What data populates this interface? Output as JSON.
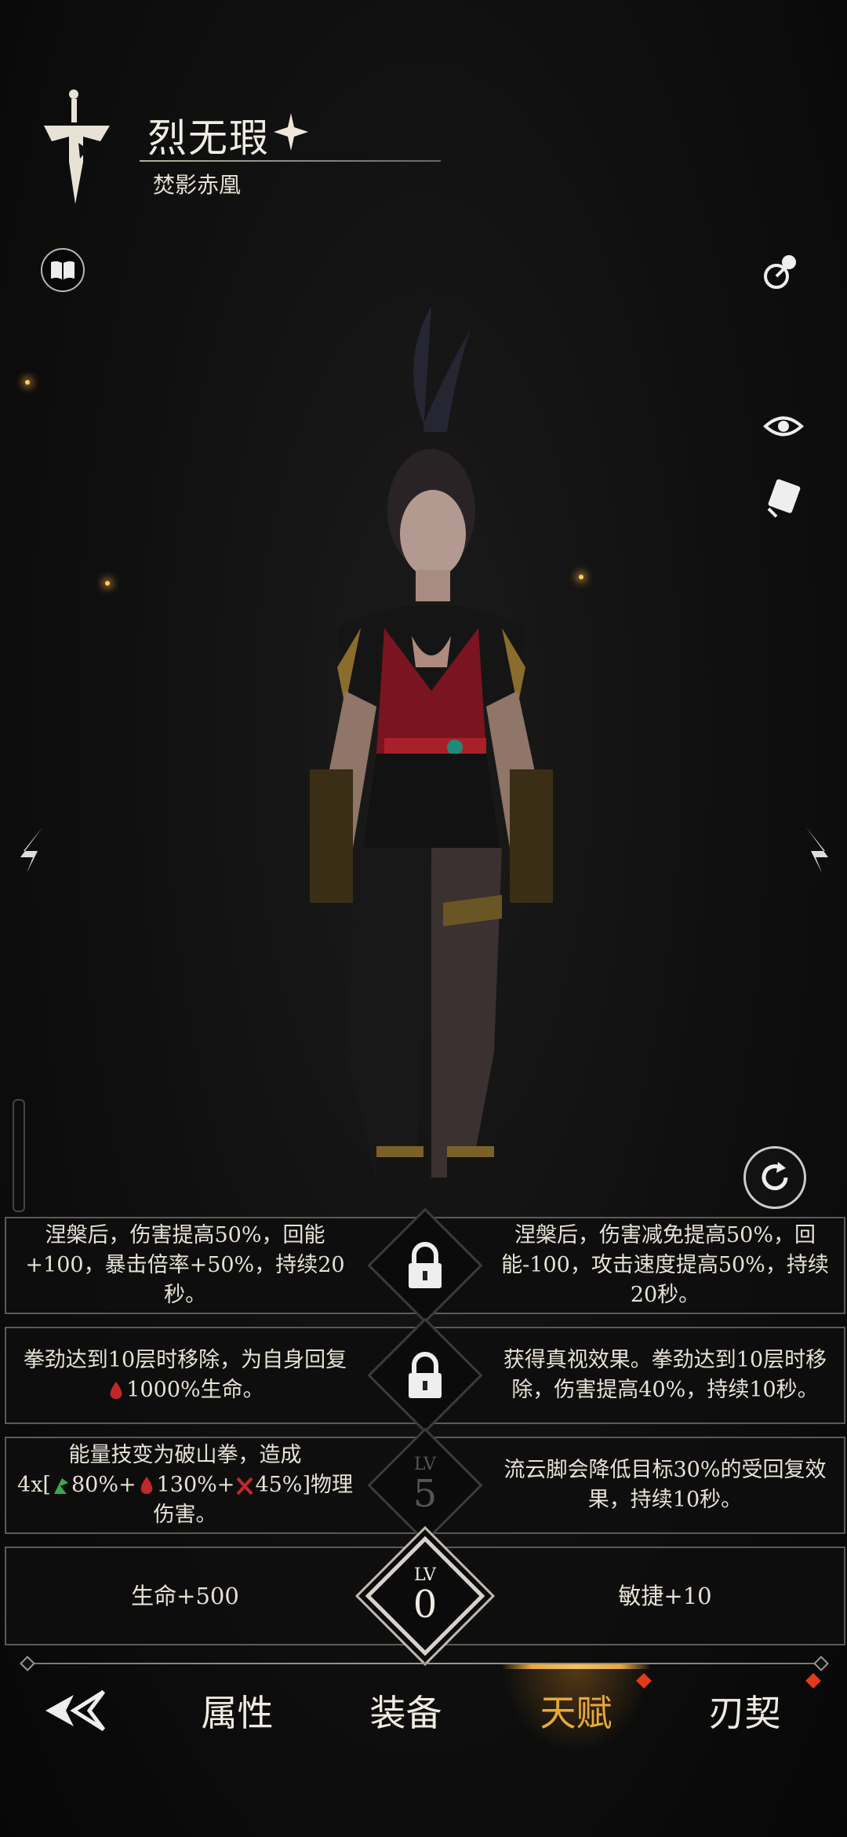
{
  "header": {
    "name": "烈无瑕",
    "subtitle": "焚影赤凰"
  },
  "icons": {
    "book": "book-icon",
    "swap": "swap-icon",
    "eye": "eye-icon",
    "card": "card-icon",
    "prev": "chevron-left-icon",
    "next": "chevron-right-icon",
    "refresh": "refresh-icon",
    "back": "back-icon",
    "sword": "sword-emblem-icon",
    "star": "star-icon"
  },
  "talents": [
    {
      "left": "涅槃后，伤害提高50%，回能+100，暴击倍率+50%，持续20秒。",
      "right": "涅槃后，伤害减免提高50%，回能-100，攻击速度提高50%，持续20秒。",
      "locked": true
    },
    {
      "left_pre": "拳劲达到10层时移除，为自身回复",
      "left_post": "1000%生命。",
      "right": "获得真视效果。拳劲达到10层时移除，伤害提高40%，持续10秒。",
      "locked": true
    },
    {
      "left_line1": "能量技变为破山拳，造成",
      "left_line2_a": "4x[",
      "left_line2_b": "80%+",
      "left_line2_c": "130%+",
      "left_line2_d": "45%]物理",
      "left_line3": "伤害。",
      "right": "流云脚会降低目标30%的受回复效果，持续10秒。",
      "lv_label": "LV",
      "lv": "5"
    },
    {
      "left": "生命+500",
      "right": "敏捷+10",
      "lv_label": "LV",
      "lv": "0"
    }
  ],
  "nav": {
    "tabs": [
      "属性",
      "装备",
      "天赋",
      "刃契"
    ],
    "active": "天赋"
  },
  "colors": {
    "accent": "#e9a83b",
    "badge": "#e23a1a"
  }
}
